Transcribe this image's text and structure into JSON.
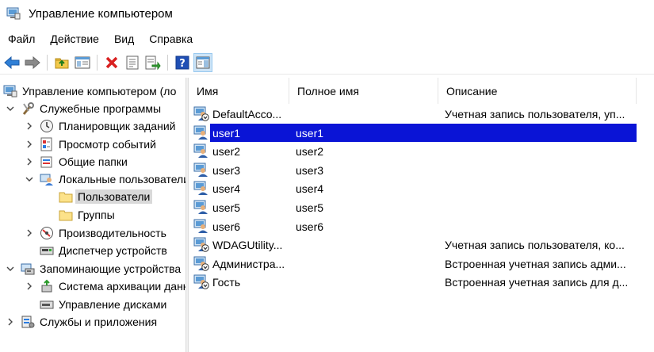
{
  "window": {
    "title": "Управление компьютером"
  },
  "menu": [
    "Файл",
    "Действие",
    "Вид",
    "Справка"
  ],
  "toolbar": {
    "buttons": [
      "back-icon",
      "forward-icon",
      "up-folder-icon",
      "show-hide-tree-icon",
      "delete-icon",
      "properties-icon",
      "export-list-icon",
      "help-icon",
      "show-hide-action-pane-icon"
    ]
  },
  "tree": {
    "items": [
      {
        "label": "Управление компьютером (ло",
        "icon": "computer-management-icon",
        "level": 0,
        "chevron": ""
      },
      {
        "label": "Служебные программы",
        "icon": "tools-icon",
        "level": 0,
        "chevron": "down"
      },
      {
        "label": "Планировщик заданий",
        "icon": "clock-icon",
        "level": 1,
        "chevron": "right"
      },
      {
        "label": "Просмотр событий",
        "icon": "event-viewer-icon",
        "level": 1,
        "chevron": "right"
      },
      {
        "label": "Общие папки",
        "icon": "shared-folders-icon",
        "level": 1,
        "chevron": "right"
      },
      {
        "label": "Локальные пользователи",
        "icon": "users-icon",
        "level": 1,
        "chevron": "down"
      },
      {
        "label": "Пользователи",
        "icon": "folder-icon",
        "level": 2,
        "chevron": "",
        "selected": true
      },
      {
        "label": "Группы",
        "icon": "folder-icon",
        "level": 2,
        "chevron": ""
      },
      {
        "label": "Производительность",
        "icon": "performance-icon",
        "level": 1,
        "chevron": "right"
      },
      {
        "label": "Диспетчер устройств",
        "icon": "device-manager-icon",
        "level": 1,
        "chevron": ""
      },
      {
        "label": "Запоминающие устройства",
        "icon": "storage-icon",
        "level": 0,
        "chevron": "down"
      },
      {
        "label": "Система архивации данных",
        "icon": "backup-icon",
        "level": 1,
        "chevron": "right"
      },
      {
        "label": "Управление дисками",
        "icon": "disk-management-icon",
        "level": 1,
        "chevron": ""
      },
      {
        "label": "Службы и приложения",
        "icon": "services-icon",
        "level": 0,
        "chevron": "right"
      }
    ]
  },
  "list": {
    "columns": [
      "Имя",
      "Полное имя",
      "Описание"
    ],
    "rows": [
      {
        "name": "DefaultAcco...",
        "full": "",
        "desc": "Учетная запись пользователя, уп...",
        "disabled": true
      },
      {
        "name": "user1",
        "full": "user1",
        "desc": "",
        "selected": true
      },
      {
        "name": "user2",
        "full": "user2",
        "desc": ""
      },
      {
        "name": "user3",
        "full": "user3",
        "desc": ""
      },
      {
        "name": "user4",
        "full": "user4",
        "desc": ""
      },
      {
        "name": "user5",
        "full": "user5",
        "desc": ""
      },
      {
        "name": "user6",
        "full": "user6",
        "desc": ""
      },
      {
        "name": "WDAGUtility...",
        "full": "",
        "desc": "Учетная запись пользователя, ко...",
        "disabled": true
      },
      {
        "name": "Администра...",
        "full": "",
        "desc": "Встроенная учетная запись адми...",
        "disabled": true
      },
      {
        "name": "Гость",
        "full": "",
        "desc": "Встроенная учетная запись для д...",
        "disabled": true
      }
    ]
  },
  "colors": {
    "selection": "#0a14d6",
    "tree_selection": "#d9d9d9"
  }
}
